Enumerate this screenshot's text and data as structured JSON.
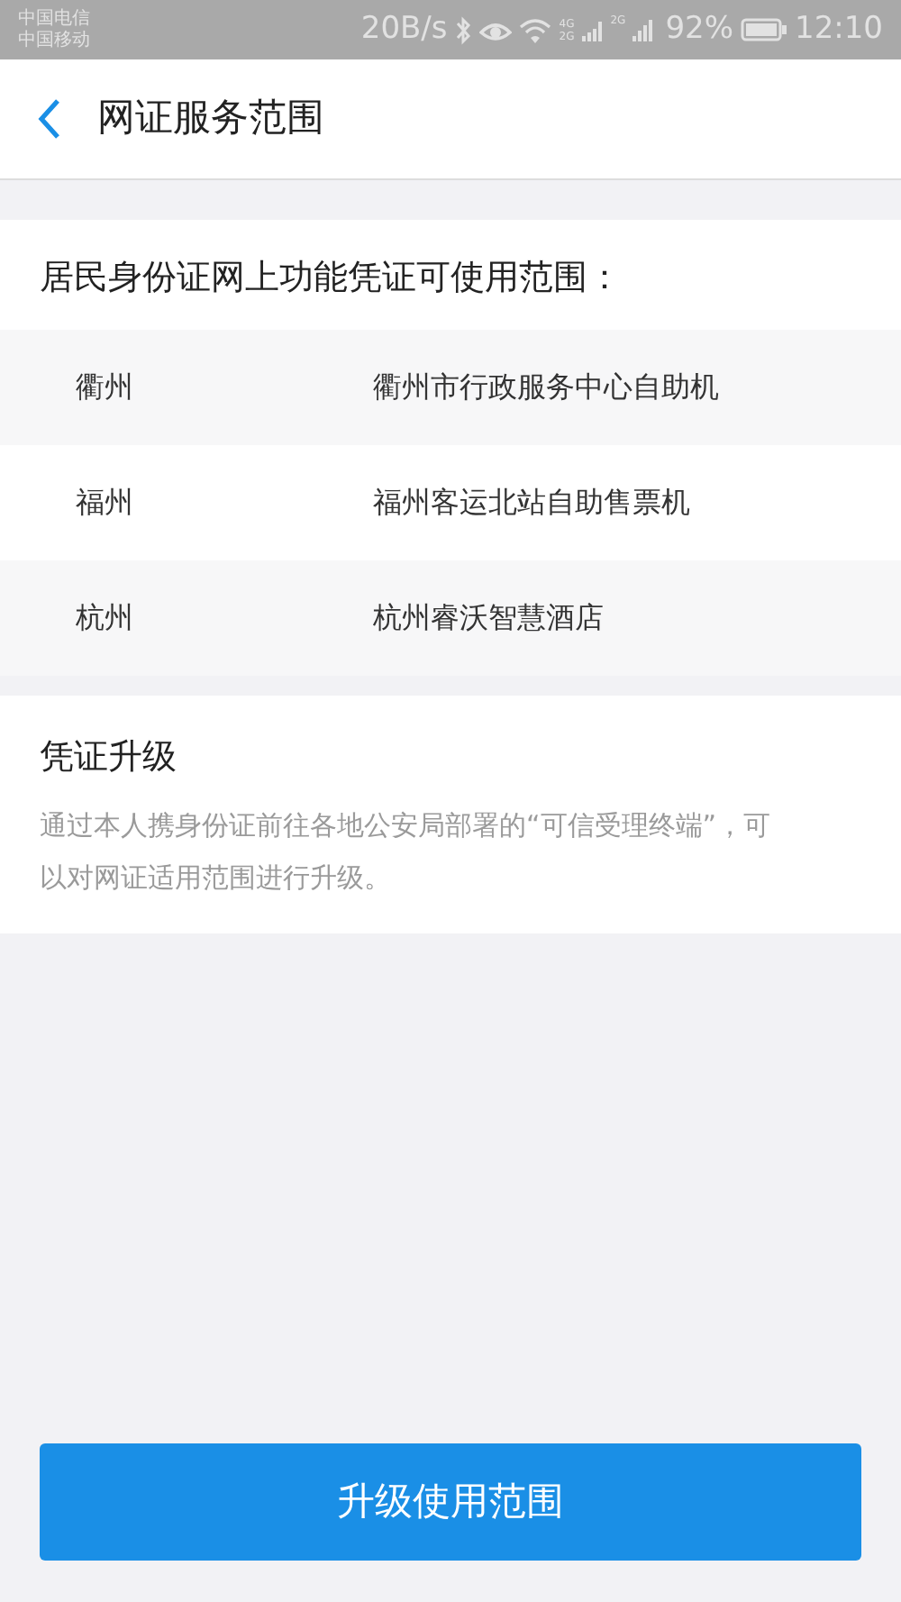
{
  "status_bar": {
    "carriers": [
      "中国电信",
      "中国移动"
    ],
    "speed": "20B/s",
    "sim1_labels": [
      "4G",
      "2G"
    ],
    "sim2_label": "2G",
    "battery": "92%",
    "time": "12:10"
  },
  "header": {
    "title": "网证服务范围"
  },
  "scope": {
    "heading": "居民身份证网上功能凭证可使用范围：",
    "rows": [
      {
        "city": "衢州",
        "place": "衢州市行政服务中心自助机"
      },
      {
        "city": "福州",
        "place": "福州客运北站自助售票机"
      },
      {
        "city": "杭州",
        "place": "杭州睿沃智慧酒店"
      }
    ]
  },
  "upgrade": {
    "title": "凭证升级",
    "text": "通过本人携身份证前往各地公安局部署的“可信受理终端”，可以对网证适用范围进行升级。"
  },
  "button": {
    "label": "升级使用范围"
  }
}
